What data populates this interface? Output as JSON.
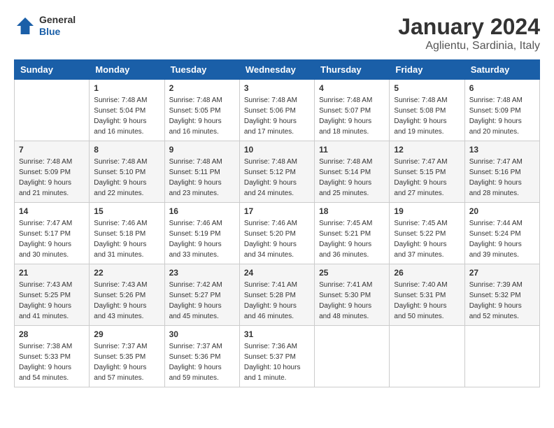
{
  "header": {
    "logo_general": "General",
    "logo_blue": "Blue",
    "month_title": "January 2024",
    "location": "Aglientu, Sardinia, Italy"
  },
  "weekdays": [
    "Sunday",
    "Monday",
    "Tuesday",
    "Wednesday",
    "Thursday",
    "Friday",
    "Saturday"
  ],
  "weeks": [
    [
      {
        "day": "",
        "sunrise": "",
        "sunset": "",
        "daylight": ""
      },
      {
        "day": "1",
        "sunrise": "Sunrise: 7:48 AM",
        "sunset": "Sunset: 5:04 PM",
        "daylight": "Daylight: 9 hours and 16 minutes."
      },
      {
        "day": "2",
        "sunrise": "Sunrise: 7:48 AM",
        "sunset": "Sunset: 5:05 PM",
        "daylight": "Daylight: 9 hours and 16 minutes."
      },
      {
        "day": "3",
        "sunrise": "Sunrise: 7:48 AM",
        "sunset": "Sunset: 5:06 PM",
        "daylight": "Daylight: 9 hours and 17 minutes."
      },
      {
        "day": "4",
        "sunrise": "Sunrise: 7:48 AM",
        "sunset": "Sunset: 5:07 PM",
        "daylight": "Daylight: 9 hours and 18 minutes."
      },
      {
        "day": "5",
        "sunrise": "Sunrise: 7:48 AM",
        "sunset": "Sunset: 5:08 PM",
        "daylight": "Daylight: 9 hours and 19 minutes."
      },
      {
        "day": "6",
        "sunrise": "Sunrise: 7:48 AM",
        "sunset": "Sunset: 5:09 PM",
        "daylight": "Daylight: 9 hours and 20 minutes."
      }
    ],
    [
      {
        "day": "7",
        "sunrise": "Sunrise: 7:48 AM",
        "sunset": "Sunset: 5:09 PM",
        "daylight": "Daylight: 9 hours and 21 minutes."
      },
      {
        "day": "8",
        "sunrise": "Sunrise: 7:48 AM",
        "sunset": "Sunset: 5:10 PM",
        "daylight": "Daylight: 9 hours and 22 minutes."
      },
      {
        "day": "9",
        "sunrise": "Sunrise: 7:48 AM",
        "sunset": "Sunset: 5:11 PM",
        "daylight": "Daylight: 9 hours and 23 minutes."
      },
      {
        "day": "10",
        "sunrise": "Sunrise: 7:48 AM",
        "sunset": "Sunset: 5:12 PM",
        "daylight": "Daylight: 9 hours and 24 minutes."
      },
      {
        "day": "11",
        "sunrise": "Sunrise: 7:48 AM",
        "sunset": "Sunset: 5:14 PM",
        "daylight": "Daylight: 9 hours and 25 minutes."
      },
      {
        "day": "12",
        "sunrise": "Sunrise: 7:47 AM",
        "sunset": "Sunset: 5:15 PM",
        "daylight": "Daylight: 9 hours and 27 minutes."
      },
      {
        "day": "13",
        "sunrise": "Sunrise: 7:47 AM",
        "sunset": "Sunset: 5:16 PM",
        "daylight": "Daylight: 9 hours and 28 minutes."
      }
    ],
    [
      {
        "day": "14",
        "sunrise": "Sunrise: 7:47 AM",
        "sunset": "Sunset: 5:17 PM",
        "daylight": "Daylight: 9 hours and 30 minutes."
      },
      {
        "day": "15",
        "sunrise": "Sunrise: 7:46 AM",
        "sunset": "Sunset: 5:18 PM",
        "daylight": "Daylight: 9 hours and 31 minutes."
      },
      {
        "day": "16",
        "sunrise": "Sunrise: 7:46 AM",
        "sunset": "Sunset: 5:19 PM",
        "daylight": "Daylight: 9 hours and 33 minutes."
      },
      {
        "day": "17",
        "sunrise": "Sunrise: 7:46 AM",
        "sunset": "Sunset: 5:20 PM",
        "daylight": "Daylight: 9 hours and 34 minutes."
      },
      {
        "day": "18",
        "sunrise": "Sunrise: 7:45 AM",
        "sunset": "Sunset: 5:21 PM",
        "daylight": "Daylight: 9 hours and 36 minutes."
      },
      {
        "day": "19",
        "sunrise": "Sunrise: 7:45 AM",
        "sunset": "Sunset: 5:22 PM",
        "daylight": "Daylight: 9 hours and 37 minutes."
      },
      {
        "day": "20",
        "sunrise": "Sunrise: 7:44 AM",
        "sunset": "Sunset: 5:24 PM",
        "daylight": "Daylight: 9 hours and 39 minutes."
      }
    ],
    [
      {
        "day": "21",
        "sunrise": "Sunrise: 7:43 AM",
        "sunset": "Sunset: 5:25 PM",
        "daylight": "Daylight: 9 hours and 41 minutes."
      },
      {
        "day": "22",
        "sunrise": "Sunrise: 7:43 AM",
        "sunset": "Sunset: 5:26 PM",
        "daylight": "Daylight: 9 hours and 43 minutes."
      },
      {
        "day": "23",
        "sunrise": "Sunrise: 7:42 AM",
        "sunset": "Sunset: 5:27 PM",
        "daylight": "Daylight: 9 hours and 45 minutes."
      },
      {
        "day": "24",
        "sunrise": "Sunrise: 7:41 AM",
        "sunset": "Sunset: 5:28 PM",
        "daylight": "Daylight: 9 hours and 46 minutes."
      },
      {
        "day": "25",
        "sunrise": "Sunrise: 7:41 AM",
        "sunset": "Sunset: 5:30 PM",
        "daylight": "Daylight: 9 hours and 48 minutes."
      },
      {
        "day": "26",
        "sunrise": "Sunrise: 7:40 AM",
        "sunset": "Sunset: 5:31 PM",
        "daylight": "Daylight: 9 hours and 50 minutes."
      },
      {
        "day": "27",
        "sunrise": "Sunrise: 7:39 AM",
        "sunset": "Sunset: 5:32 PM",
        "daylight": "Daylight: 9 hours and 52 minutes."
      }
    ],
    [
      {
        "day": "28",
        "sunrise": "Sunrise: 7:38 AM",
        "sunset": "Sunset: 5:33 PM",
        "daylight": "Daylight: 9 hours and 54 minutes."
      },
      {
        "day": "29",
        "sunrise": "Sunrise: 7:37 AM",
        "sunset": "Sunset: 5:35 PM",
        "daylight": "Daylight: 9 hours and 57 minutes."
      },
      {
        "day": "30",
        "sunrise": "Sunrise: 7:37 AM",
        "sunset": "Sunset: 5:36 PM",
        "daylight": "Daylight: 9 hours and 59 minutes."
      },
      {
        "day": "31",
        "sunrise": "Sunrise: 7:36 AM",
        "sunset": "Sunset: 5:37 PM",
        "daylight": "Daylight: 10 hours and 1 minute."
      },
      {
        "day": "",
        "sunrise": "",
        "sunset": "",
        "daylight": ""
      },
      {
        "day": "",
        "sunrise": "",
        "sunset": "",
        "daylight": ""
      },
      {
        "day": "",
        "sunrise": "",
        "sunset": "",
        "daylight": ""
      }
    ]
  ]
}
